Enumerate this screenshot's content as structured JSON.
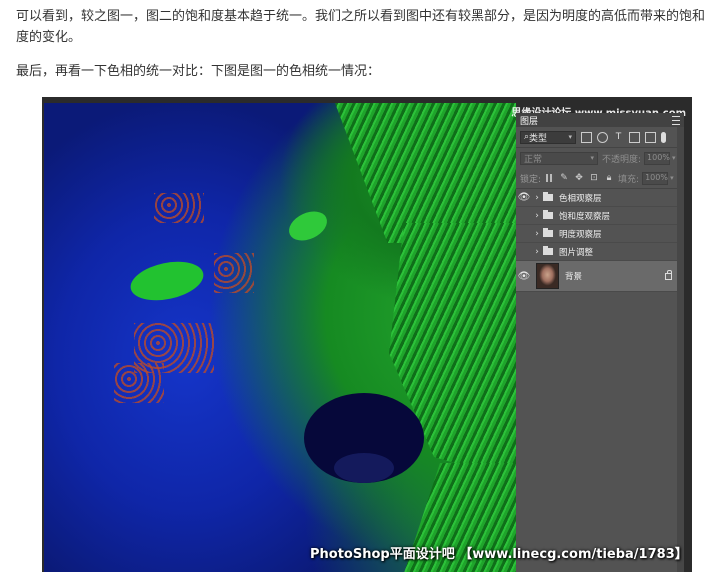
{
  "article": {
    "paragraph1": "可以看到，较之图一，图二的饱和度基本趋于统一。我们之所以看到图中还有较黑部分，是因为明度的高低而带来的饱和度的变化。",
    "paragraph2": "最后，再看一下色相的统一对比：下图是图一的色相统一情况："
  },
  "screenshot": {
    "corner_watermark": "思缘设计论坛 www.missyuan.com",
    "watermark": "PhotoShop平面设计吧 【www.linecg.com/tieba/1783】",
    "layers_panel": {
      "title": "图层",
      "filter_label": "类型",
      "blend_mode": "正常",
      "opacity_label": "不透明度:",
      "opacity_value": "100%",
      "lock_label": "锁定:",
      "fill_label": "填充:",
      "fill_value": "100%",
      "layers": [
        {
          "name": "色相观察层",
          "visible": true
        },
        {
          "name": "饱和度观察层",
          "visible": false
        },
        {
          "name": "明度观察层",
          "visible": false
        },
        {
          "name": "图片调整",
          "visible": false
        }
      ],
      "background_layer": {
        "name": "背景",
        "visible": true,
        "locked": true
      }
    }
  }
}
